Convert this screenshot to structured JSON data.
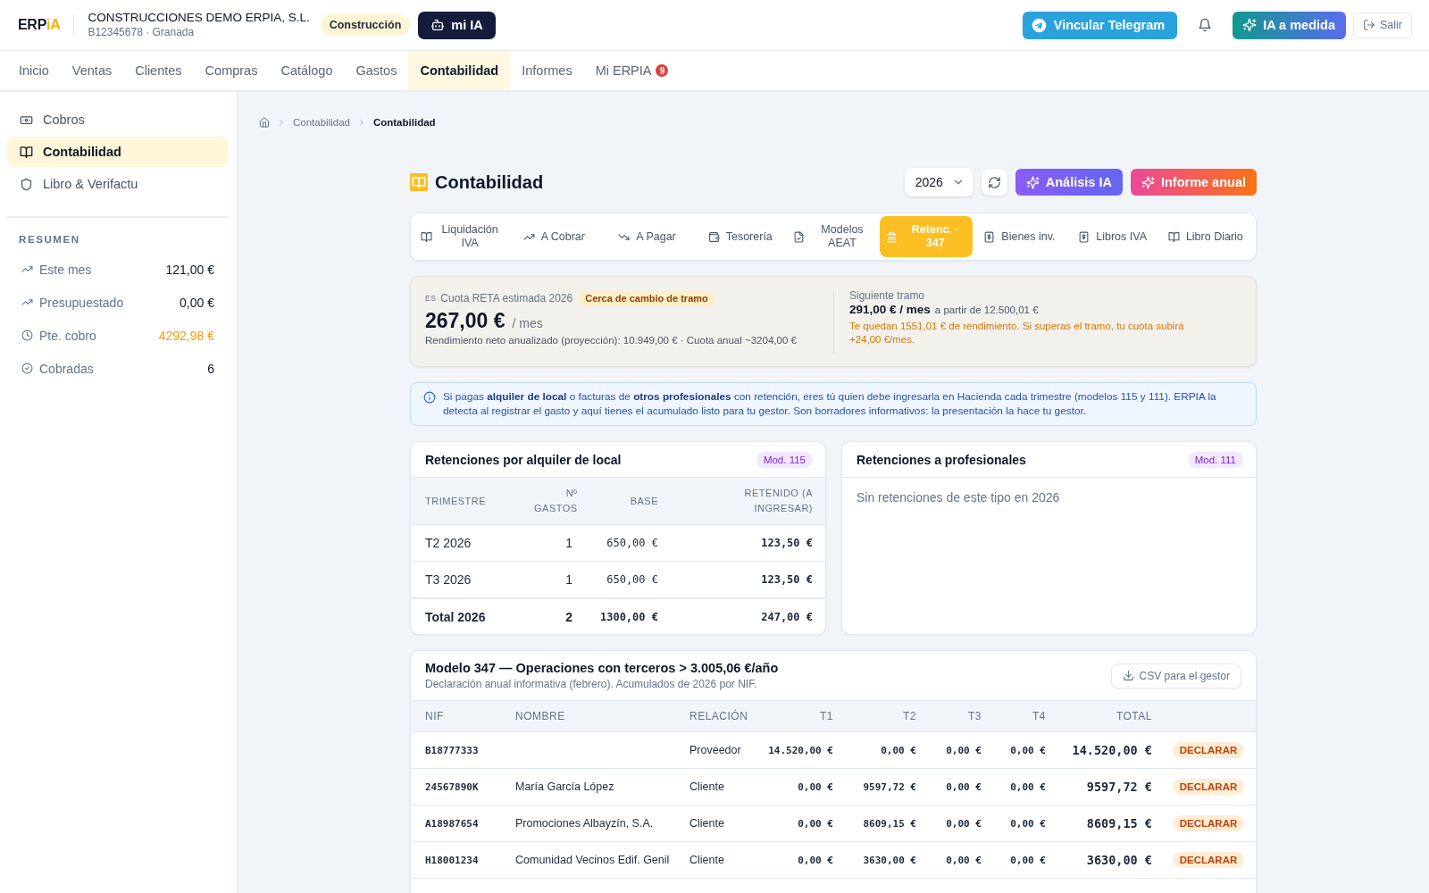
{
  "header": {
    "logo": [
      "ERP",
      "iA"
    ],
    "company": "CONSTRUCCIONES DEMO ERPIA, S.L.",
    "company_meta": "B12345678 · Granada",
    "sector_badge": "Construcción",
    "ai_button": "mi IA",
    "telegram_button": "Vincular Telegram",
    "custom_ai_button": "IA a medida",
    "logout_button": "Salir"
  },
  "nav": [
    {
      "label": "Inicio",
      "selected": false
    },
    {
      "label": "Ventas",
      "selected": false
    },
    {
      "label": "Clientes",
      "selected": false
    },
    {
      "label": "Compras",
      "selected": false
    },
    {
      "label": "Catálogo",
      "selected": false
    },
    {
      "label": "Gastos",
      "selected": false
    },
    {
      "label": "Contabilidad",
      "selected": true
    },
    {
      "label": "Informes",
      "selected": false
    },
    {
      "label": "Mi ERPIA",
      "selected": false,
      "badge": "9"
    }
  ],
  "sidebar": {
    "items": [
      {
        "label": "Cobros",
        "selected": false
      },
      {
        "label": "Contabilidad",
        "selected": true
      },
      {
        "label": "Libro & Verifactu",
        "selected": false
      }
    ],
    "summary_title": "RESUMEN",
    "summary": [
      {
        "label": "Este mes",
        "value": "121,00 €",
        "highlight": false
      },
      {
        "label": "Presupuestado",
        "value": "0,00 €",
        "highlight": false
      },
      {
        "label": "Pte. cobro",
        "value": "4292,98 €",
        "highlight": true
      },
      {
        "label": "Cobradas",
        "value": "6",
        "highlight": false
      }
    ]
  },
  "breadcrumb": [
    "Contabilidad",
    "Contabilidad"
  ],
  "page": {
    "title": "Contabilidad",
    "year": "2026",
    "ai_analysis_button": "Análisis IA",
    "annual_report_button": "Informe anual"
  },
  "tabs": [
    {
      "label": "Liquidación IVA",
      "selected": false
    },
    {
      "label": "A Cobrar",
      "selected": false
    },
    {
      "label": "A Pagar",
      "selected": false
    },
    {
      "label": "Tesorería",
      "selected": false
    },
    {
      "label": "Modelos AEAT",
      "selected": false
    },
    {
      "label": "Retenc. · 347",
      "selected": true
    },
    {
      "label": "Bienes inv.",
      "selected": false
    },
    {
      "label": "Libros IVA",
      "selected": false
    },
    {
      "label": "Libro Diario",
      "selected": false
    }
  ],
  "reta": {
    "flag": "ES",
    "label": "Cuota RETA estimada 2026",
    "badge": "Cerca de cambio de tramo",
    "amount": "267,00 €",
    "unit": "/ mes",
    "detail": "Rendimiento neto anualizado (proyección): 10.949,00 € · Cuota anual ~3204,00 €",
    "next_label": "Siguiente tramo",
    "next_amount": "291,00 € / mes",
    "next_threshold": "a partir de 12.500,01 €",
    "warning": "Te quedan 1551,01 € de rendimiento. Si superas el tramo, tu cuota subirá +24,00 €/mes."
  },
  "info": "Si pagas **alquiler de local** o facturas de **otros profesionales** con retención, eres tú quien debe ingresarla en Hacienda cada trimestre (modelos 115 y 111). ERPIA la detecta al registrar el gasto y aquí tienes el acumulado listo para tu gestor. Son borradores informativos: la presentación la hace tu gestor.",
  "retention_panels": [
    {
      "title": "Retenciones por alquiler de local",
      "badge": "Mod. 115",
      "table": {
        "columns": [
          "TRIMESTRE",
          "Nº GASTOS",
          "BASE",
          "RETENIDO (A INGRESAR)"
        ],
        "rows": [
          [
            "T2 2026",
            "1",
            "650,00 €",
            "123,50 €"
          ],
          [
            "T3 2026",
            "1",
            "650,00 €",
            "123,50 €"
          ]
        ],
        "total": [
          "Total 2026",
          "2",
          "1300,00 €",
          "247,00 €"
        ]
      }
    },
    {
      "title": "Retenciones a profesionales",
      "badge": "Mod. 111",
      "empty": "Sin retenciones de este tipo en 2026"
    }
  ],
  "model_347": {
    "title": "Modelo 347 — Operaciones con terceros > 3.005,06 €/año",
    "subtitle": "Declaración anual informativa (febrero). Acumulados de 2026 por NIF.",
    "csv_button": "CSV para el gestor",
    "columns": [
      "NIF",
      "NOMBRE",
      "RELACIÓN",
      "T1",
      "T2",
      "T3",
      "T4",
      "TOTAL"
    ],
    "rows": [
      {
        "nif": "B18777333",
        "relation": "Proveedor",
        "quarters": [
          "14.520,00 €",
          "0,00 €",
          "0,00 €",
          "0,00 €"
        ],
        "total": "14.520,00 €",
        "status": "DECLARAR"
      },
      {
        "nif": "24567890K",
        "name": "María García López",
        "relation": "Cliente",
        "quarters": [
          "0,00 €",
          "9597,72 €",
          "0,00 €",
          "0,00 €"
        ],
        "total": "9597,72 €",
        "status": "DECLARAR"
      },
      {
        "nif": "A18987654",
        "name": "Promociones Albayzín, S.A.",
        "relation": "Cliente",
        "quarters": [
          "0,00 €",
          "8609,15 €",
          "0,00 €",
          "0,00 €"
        ],
        "total": "8609,15 €",
        "status": "DECLARAR"
      },
      {
        "nif": "H18001234",
        "name": "Comunidad Vecinos Edif. Genil",
        "relation": "Cliente",
        "quarters": [
          "0,00 €",
          "3630,00 €",
          "0,00 €",
          "0,00 €"
        ],
        "total": "3630,00 €",
        "status": "DECLARAR"
      }
    ]
  }
}
